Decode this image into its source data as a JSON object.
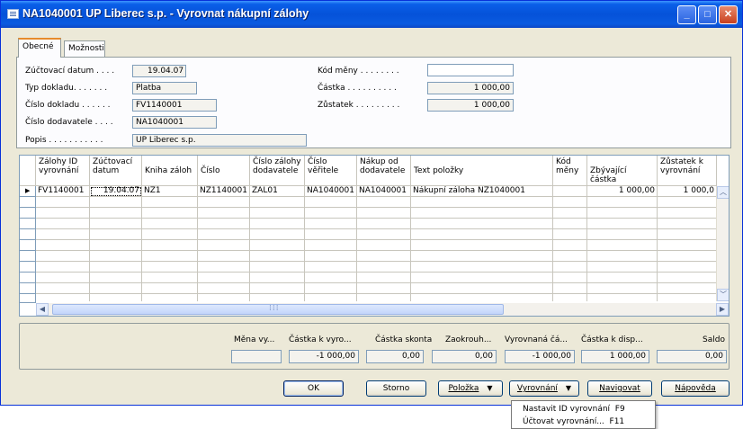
{
  "window": {
    "title": "NA1040001 UP Liberec s.p. - Vyrovnat nákupní zálohy"
  },
  "tabs": [
    "Obecné",
    "Možnosti"
  ],
  "header": {
    "left": [
      {
        "label": "Zúčtovací datum . . . .",
        "value": "19.04.07"
      },
      {
        "label": "Typ dokladu. . . . . . .",
        "value": "Platba"
      },
      {
        "label": "Číslo dokladu . . . . . .",
        "value": "FV1140001"
      },
      {
        "label": "Číslo dodavatele . . . .",
        "value": "NA1040001"
      },
      {
        "label": "Popis . . . . . . . . . . .",
        "value": "UP Liberec s.p."
      }
    ],
    "right": [
      {
        "label": "Kód měny . . . . . . . .",
        "value": ""
      },
      {
        "label": "Částka . . . . . . . . . .",
        "value": "1 000,00"
      },
      {
        "label": "Zůstatek . . . . . . . . .",
        "value": "1 000,00"
      }
    ]
  },
  "grid": {
    "columns": [
      {
        "l1": "Zálohy ID",
        "l2": "vyrovnání"
      },
      {
        "l1": "Zúčtovací",
        "l2": "datum"
      },
      {
        "l1": "",
        "l2": "Kniha záloh"
      },
      {
        "l1": "",
        "l2": "Číslo"
      },
      {
        "l1": "Číslo zálohy",
        "l2": "dodavatele"
      },
      {
        "l1": "Číslo",
        "l2": "věřitele"
      },
      {
        "l1": "Nákup od",
        "l2": "dodavatele"
      },
      {
        "l1": "",
        "l2": "Text položky"
      },
      {
        "l1": "Kód",
        "l2": "měny"
      },
      {
        "l1": "",
        "l2": "Zbývající částka"
      },
      {
        "l1": "Zůstatek k",
        "l2": "vyrovnání"
      }
    ],
    "row": [
      "FV1140001",
      "19.04.07",
      "NZ1",
      "NZ1140001",
      "ZAL01",
      "NA1040001",
      "NA1040001",
      "Nákupní záloha NZ1040001",
      "",
      "1 000,00",
      "1 000,0"
    ]
  },
  "totals": [
    {
      "label": "Měna vy...",
      "value": ""
    },
    {
      "label": "Částka k vyro...",
      "value": "-1 000,00"
    },
    {
      "label": "Částka skonta",
      "value": "0,00"
    },
    {
      "label": "Zaokrouh...",
      "value": "0,00"
    },
    {
      "label": "Vyrovnaná čá...",
      "value": "-1 000,00"
    },
    {
      "label": "Částka k disp...",
      "value": "1 000,00"
    },
    {
      "label": "Saldo",
      "value": "0,00"
    }
  ],
  "buttons": {
    "ok": "OK",
    "cancel": "Storno",
    "line": "Položka",
    "apply": "Vyrovnání",
    "navigate": "Navigovat",
    "help": "Nápověda"
  },
  "apply_menu": [
    {
      "label": "Nastavit ID vyrovnání",
      "shortcut": "F9"
    },
    {
      "label": "Účtovat vyrovnání...",
      "shortcut": "F11"
    }
  ],
  "colors": {
    "titlebar": "#0552d9",
    "window_bg": "#ece9d8",
    "tab_accent": "#e68b2c"
  },
  "icons": [
    "window-icon",
    "minimize-icon",
    "maximize-icon",
    "close-icon",
    "row-pointer-icon",
    "dropdown-arrow-icon",
    "scroll-left-icon",
    "scroll-right-icon",
    "scroll-up-icon",
    "scroll-down-icon"
  ]
}
